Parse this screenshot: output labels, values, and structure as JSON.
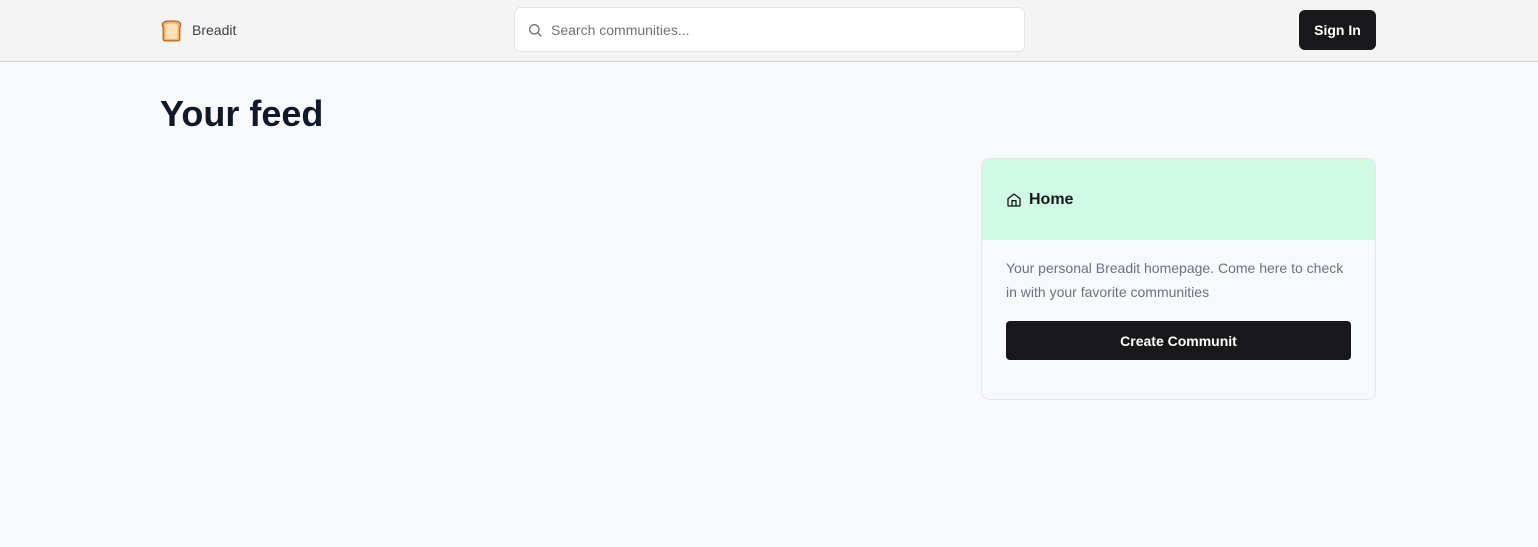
{
  "navbar": {
    "brand": {
      "name": "Breadit",
      "logo_icon": "bread-toast-icon"
    },
    "search": {
      "placeholder": "Search communities...",
      "value": "",
      "icon": "search-icon"
    },
    "sign_in_label": "Sign In"
  },
  "main": {
    "title": "Your feed"
  },
  "sidebar_card": {
    "title": "Home",
    "title_icon": "home-icon",
    "description": "Your personal Breadit homepage. Come here to check in with your favorite communities",
    "create_label": "Create Communit"
  },
  "colors": {
    "navbar_bg": "#f4f4f5",
    "page_bg": "#f8f9fa",
    "card_header_bg": "#d1fae5",
    "primary_button": "#18181b",
    "heading_text": "#111827",
    "muted_text": "#6b7280"
  }
}
